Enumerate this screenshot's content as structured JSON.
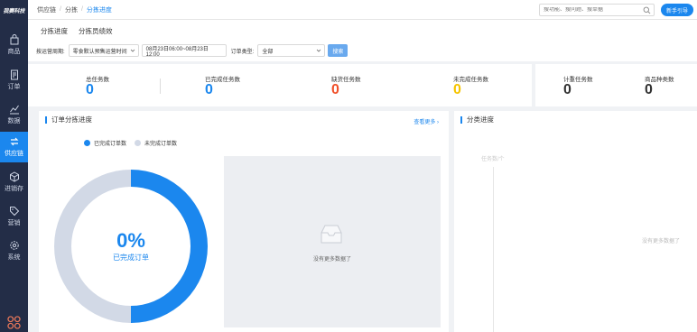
{
  "app": {
    "logo": "我赛科技"
  },
  "sidebar": {
    "items": [
      {
        "label": "商品",
        "icon": "bag-icon"
      },
      {
        "label": "订单",
        "icon": "document-icon"
      },
      {
        "label": "数据",
        "icon": "chart-line-icon"
      },
      {
        "label": "供应链",
        "icon": "exchange-icon",
        "active": true
      },
      {
        "label": "进销存",
        "icon": "box-icon"
      },
      {
        "label": "营销",
        "icon": "tag-icon"
      },
      {
        "label": "系统",
        "icon": "gear-icon"
      }
    ]
  },
  "header": {
    "breadcrumb": [
      "供应链",
      "分拣",
      "分拣进度"
    ],
    "search_placeholder": "搜功能、搜问题、搜单据",
    "help_label": "新手引导"
  },
  "tabs": [
    "分拣进度",
    "分拣员绩效"
  ],
  "filters": {
    "period_label": "按运营周期:",
    "period_value": "零食默认预售运营时间",
    "date_range": "08月23日06:00~08月23日12:00",
    "type_label": "订单类型:",
    "type_value": "全部",
    "search_label": "搜索"
  },
  "stats": [
    {
      "title": "总任务数",
      "value": "0",
      "color": "#1b87ee"
    },
    {
      "title": "已完成任务数",
      "value": "0",
      "color": "#1b87ee"
    },
    {
      "title": "缺货任务数",
      "value": "0",
      "color": "#f0502a"
    },
    {
      "title": "未完成任务数",
      "value": "0",
      "color": "#f5c400"
    }
  ],
  "stats2": [
    {
      "title": "计重任务数",
      "value": "0",
      "color": "#333333"
    },
    {
      "title": "商品种类数",
      "value": "0",
      "color": "#333333"
    }
  ],
  "order_panel": {
    "title": "订单分拣进度",
    "more": "查看更多",
    "legend": [
      {
        "label": "已完成订单数",
        "color": "#1b87ee"
      },
      {
        "label": "未完成订单数",
        "color": "#d2d9e6"
      }
    ],
    "percent": "0%",
    "percent_label": "已完成订单",
    "empty_text": "没有更多数据了"
  },
  "category_panel": {
    "title": "分类进度",
    "y_label": "任务数/个",
    "empty_text": "没有更多数据了"
  },
  "chart_data": {
    "type": "pie",
    "categories": [
      "已完成订单数",
      "未完成订单数"
    ],
    "values": [
      0,
      0
    ],
    "center_text": "0%",
    "center_label": "已完成订单",
    "legend_position": "top"
  }
}
